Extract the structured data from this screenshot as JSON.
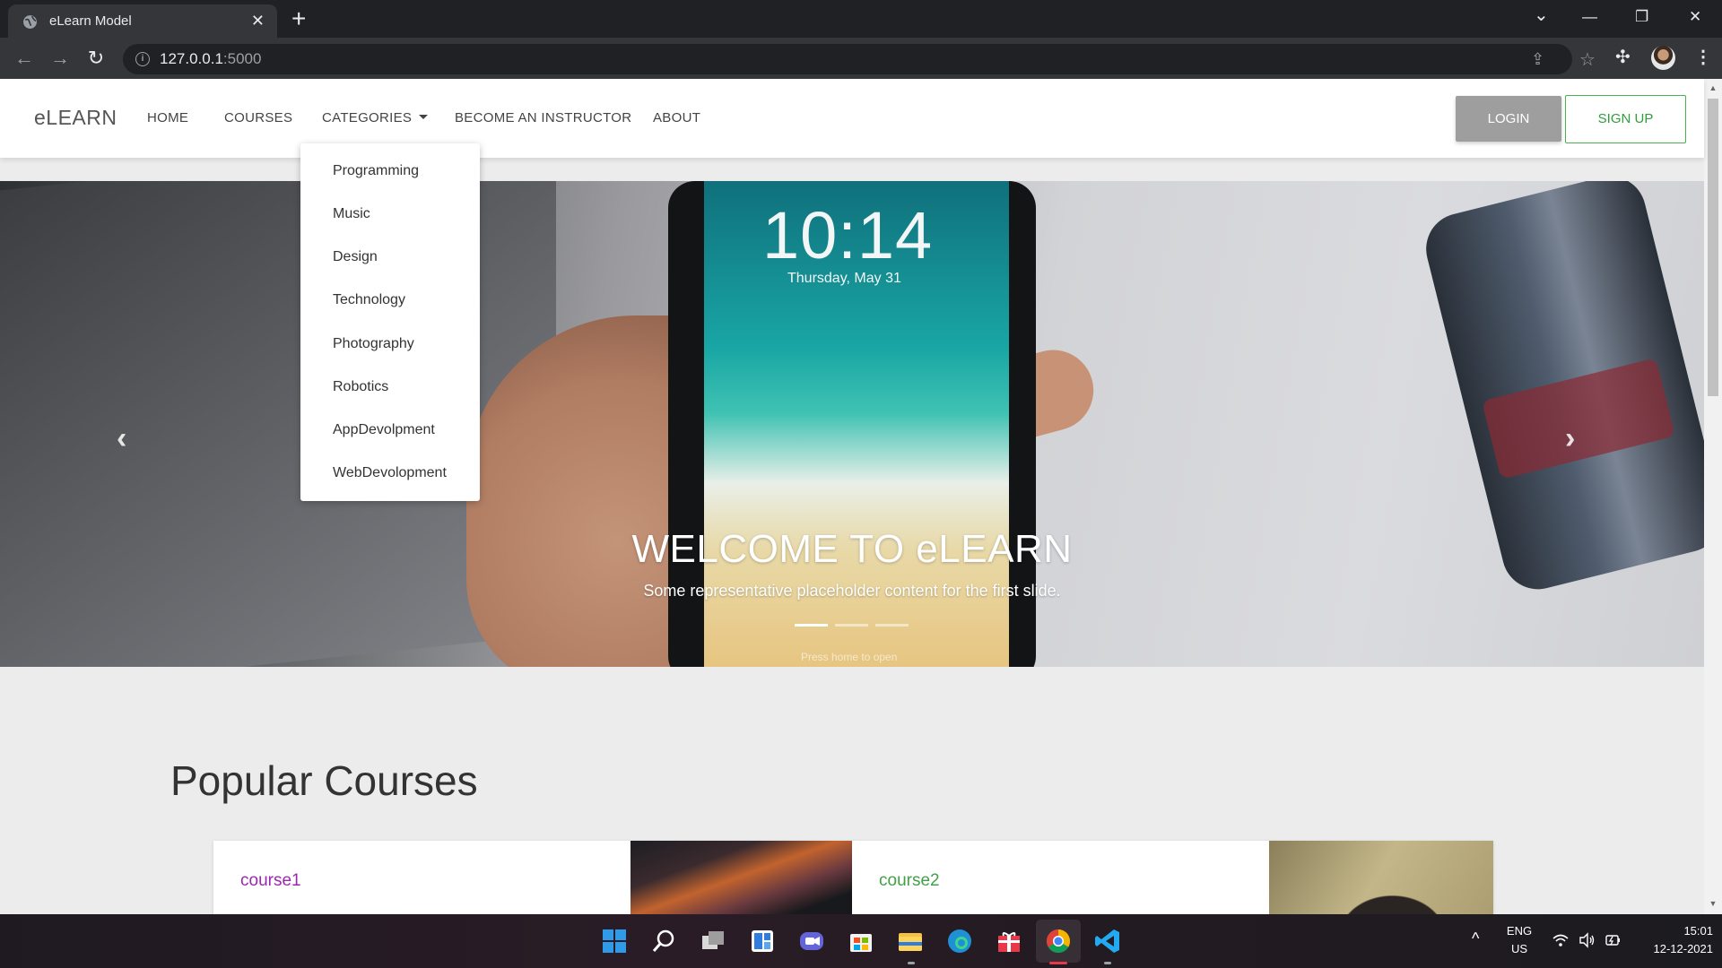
{
  "browser": {
    "tab_title": "eLearn Model",
    "tab_close": "✕",
    "new_tab": "+",
    "url_host": "127.0.0.1",
    "url_port": ":5000",
    "window_controls": {
      "tab_search": "⌄",
      "minimize": "—",
      "restore": "❐",
      "close": "✕"
    }
  },
  "site": {
    "brand": "eLEARN",
    "nav": {
      "home": "HOME",
      "courses": "COURSES",
      "categories": "CATEGORIES",
      "become_instructor": "BECOME AN INSTRUCTOR",
      "about": "ABOUT"
    },
    "login": "LOGIN",
    "signup": "SIGN UP",
    "categories_menu": [
      "Programming",
      "Music",
      "Design",
      "Technology",
      "Photography",
      "Robotics",
      "AppDevolpment",
      "WebDevolopment"
    ]
  },
  "hero": {
    "lock_time": "10:14",
    "lock_date": "Thursday, May 31",
    "lock_hint": "Press home to open",
    "title": "WELCOME TO eLEARN",
    "text": "Some representative placeholder content for the first slide.",
    "active_slide": 1,
    "slides": 3
  },
  "popular": {
    "title": "Popular Courses",
    "courses": [
      {
        "title": "course1",
        "title_color": "#9c27b0"
      },
      {
        "title": "course2",
        "title_color": "#43a047"
      }
    ]
  },
  "taskbar": {
    "lang_top": "ENG",
    "lang_bottom": "US",
    "time": "15:01",
    "date": "12-12-2021",
    "apps": [
      "windows-start",
      "search",
      "task-view",
      "widgets",
      "teams-chat",
      "microsoft-store",
      "file-explorer",
      "edge",
      "gift-app",
      "chrome",
      "vscode"
    ]
  },
  "colors": {
    "signup_border": "#4caf50",
    "login_bg": "#9e9e9e",
    "page_bg": "#ececec"
  }
}
